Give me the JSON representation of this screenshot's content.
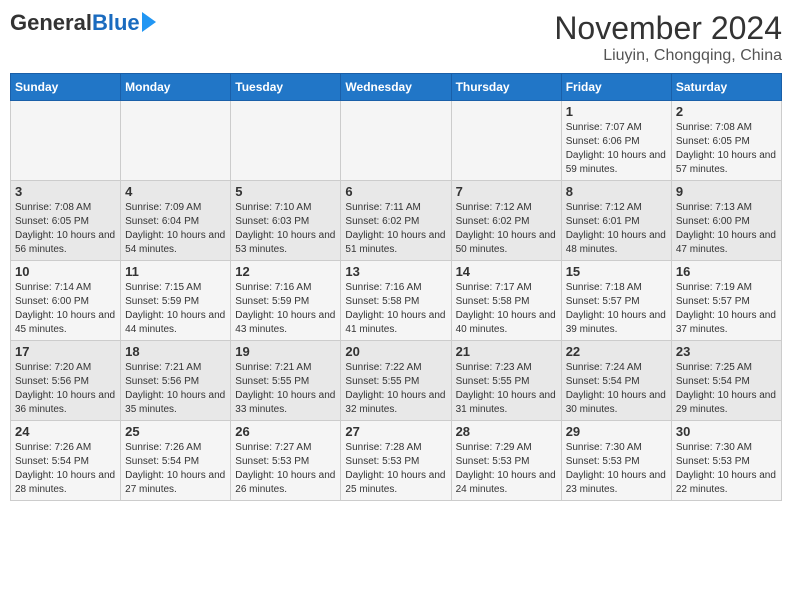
{
  "header": {
    "logo_general": "General",
    "logo_blue": "Blue",
    "title": "November 2024",
    "subtitle": "Liuyin, Chongqing, China"
  },
  "weekdays": [
    "Sunday",
    "Monday",
    "Tuesday",
    "Wednesday",
    "Thursday",
    "Friday",
    "Saturday"
  ],
  "weeks": [
    [
      {
        "day": "",
        "info": ""
      },
      {
        "day": "",
        "info": ""
      },
      {
        "day": "",
        "info": ""
      },
      {
        "day": "",
        "info": ""
      },
      {
        "day": "",
        "info": ""
      },
      {
        "day": "1",
        "info": "Sunrise: 7:07 AM\nSunset: 6:06 PM\nDaylight: 10 hours and 59 minutes."
      },
      {
        "day": "2",
        "info": "Sunrise: 7:08 AM\nSunset: 6:05 PM\nDaylight: 10 hours and 57 minutes."
      }
    ],
    [
      {
        "day": "3",
        "info": "Sunrise: 7:08 AM\nSunset: 6:05 PM\nDaylight: 10 hours and 56 minutes."
      },
      {
        "day": "4",
        "info": "Sunrise: 7:09 AM\nSunset: 6:04 PM\nDaylight: 10 hours and 54 minutes."
      },
      {
        "day": "5",
        "info": "Sunrise: 7:10 AM\nSunset: 6:03 PM\nDaylight: 10 hours and 53 minutes."
      },
      {
        "day": "6",
        "info": "Sunrise: 7:11 AM\nSunset: 6:02 PM\nDaylight: 10 hours and 51 minutes."
      },
      {
        "day": "7",
        "info": "Sunrise: 7:12 AM\nSunset: 6:02 PM\nDaylight: 10 hours and 50 minutes."
      },
      {
        "day": "8",
        "info": "Sunrise: 7:12 AM\nSunset: 6:01 PM\nDaylight: 10 hours and 48 minutes."
      },
      {
        "day": "9",
        "info": "Sunrise: 7:13 AM\nSunset: 6:00 PM\nDaylight: 10 hours and 47 minutes."
      }
    ],
    [
      {
        "day": "10",
        "info": "Sunrise: 7:14 AM\nSunset: 6:00 PM\nDaylight: 10 hours and 45 minutes."
      },
      {
        "day": "11",
        "info": "Sunrise: 7:15 AM\nSunset: 5:59 PM\nDaylight: 10 hours and 44 minutes."
      },
      {
        "day": "12",
        "info": "Sunrise: 7:16 AM\nSunset: 5:59 PM\nDaylight: 10 hours and 43 minutes."
      },
      {
        "day": "13",
        "info": "Sunrise: 7:16 AM\nSunset: 5:58 PM\nDaylight: 10 hours and 41 minutes."
      },
      {
        "day": "14",
        "info": "Sunrise: 7:17 AM\nSunset: 5:58 PM\nDaylight: 10 hours and 40 minutes."
      },
      {
        "day": "15",
        "info": "Sunrise: 7:18 AM\nSunset: 5:57 PM\nDaylight: 10 hours and 39 minutes."
      },
      {
        "day": "16",
        "info": "Sunrise: 7:19 AM\nSunset: 5:57 PM\nDaylight: 10 hours and 37 minutes."
      }
    ],
    [
      {
        "day": "17",
        "info": "Sunrise: 7:20 AM\nSunset: 5:56 PM\nDaylight: 10 hours and 36 minutes."
      },
      {
        "day": "18",
        "info": "Sunrise: 7:21 AM\nSunset: 5:56 PM\nDaylight: 10 hours and 35 minutes."
      },
      {
        "day": "19",
        "info": "Sunrise: 7:21 AM\nSunset: 5:55 PM\nDaylight: 10 hours and 33 minutes."
      },
      {
        "day": "20",
        "info": "Sunrise: 7:22 AM\nSunset: 5:55 PM\nDaylight: 10 hours and 32 minutes."
      },
      {
        "day": "21",
        "info": "Sunrise: 7:23 AM\nSunset: 5:55 PM\nDaylight: 10 hours and 31 minutes."
      },
      {
        "day": "22",
        "info": "Sunrise: 7:24 AM\nSunset: 5:54 PM\nDaylight: 10 hours and 30 minutes."
      },
      {
        "day": "23",
        "info": "Sunrise: 7:25 AM\nSunset: 5:54 PM\nDaylight: 10 hours and 29 minutes."
      }
    ],
    [
      {
        "day": "24",
        "info": "Sunrise: 7:26 AM\nSunset: 5:54 PM\nDaylight: 10 hours and 28 minutes."
      },
      {
        "day": "25",
        "info": "Sunrise: 7:26 AM\nSunset: 5:54 PM\nDaylight: 10 hours and 27 minutes."
      },
      {
        "day": "26",
        "info": "Sunrise: 7:27 AM\nSunset: 5:53 PM\nDaylight: 10 hours and 26 minutes."
      },
      {
        "day": "27",
        "info": "Sunrise: 7:28 AM\nSunset: 5:53 PM\nDaylight: 10 hours and 25 minutes."
      },
      {
        "day": "28",
        "info": "Sunrise: 7:29 AM\nSunset: 5:53 PM\nDaylight: 10 hours and 24 minutes."
      },
      {
        "day": "29",
        "info": "Sunrise: 7:30 AM\nSunset: 5:53 PM\nDaylight: 10 hours and 23 minutes."
      },
      {
        "day": "30",
        "info": "Sunrise: 7:30 AM\nSunset: 5:53 PM\nDaylight: 10 hours and 22 minutes."
      }
    ]
  ]
}
